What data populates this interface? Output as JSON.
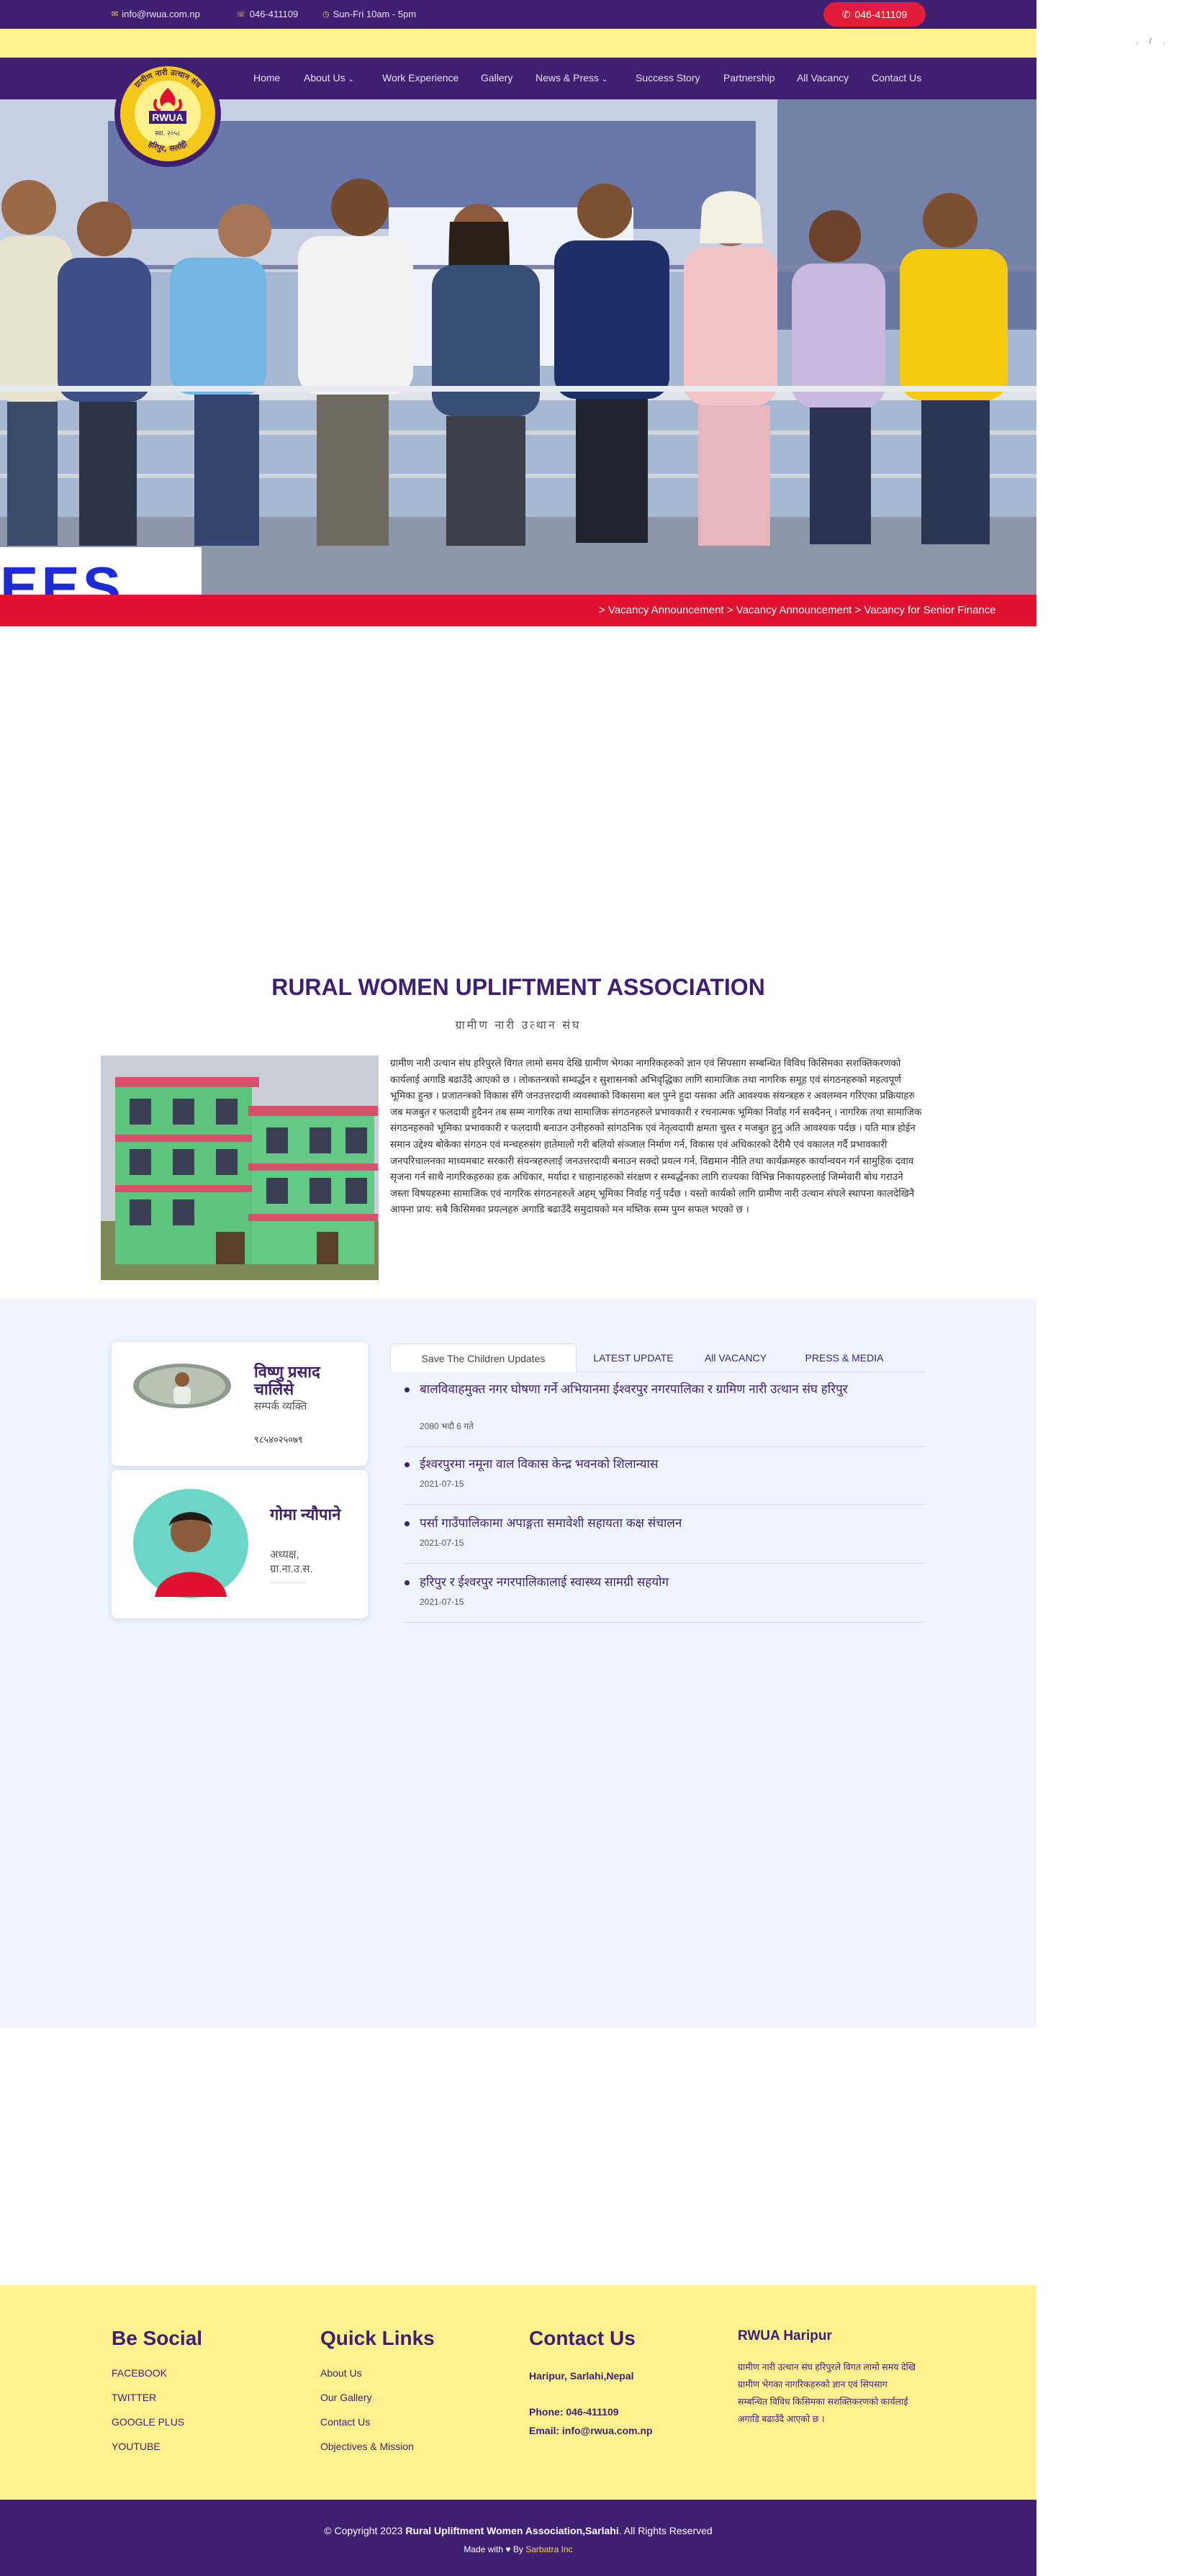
{
  "topbar": {
    "email": "info@rwua.com.np",
    "phone": "046-411109",
    "hours": "Sun-Fri 10am - 5pm",
    "call_button": "046-411109"
  },
  "corner": ". / .",
  "nav": {
    "items": [
      "Home",
      "About Us",
      "Work Experience",
      "Gallery",
      "News & Press",
      "Success Story",
      "Partnership",
      "All Vacancy",
      "Contact Us"
    ]
  },
  "logo": {
    "text_top": "ग्रामीण नारी उत्थान संघ",
    "text_bottom": "हरिपुर, सर्लाही",
    "abbr": "RWUA",
    "year": "स्था. २०५८"
  },
  "hero": {
    "card_text": "EES"
  },
  "ticker": {
    "text": "> Vacancy Announcement > Vacancy Announcement > Vacancy for Senior Finance"
  },
  "about": {
    "title": "RURAL WOMEN UPLIFTMENT ASSOCIATION",
    "subtitle": "ग्रामीण नारी उत्थान संघ",
    "body": "ग्रामीण नारी उत्थान संघ हरिपुरले विगत लामो समय देखि ग्रामीण भेगका नागरिकहरुको ज्ञान एवं सिपसाग सम्बन्धित विविध किसिमका सशक्तिकरणको कार्यलाई अगाडि बढाउँदै आएको छ । लोकतन्त्रको सम्वर्द्धन र सुशासनको अभिवृद्धिका लागि सामाजिक तथा नागरिक समूह एवं संगठनहरुको महत्वपूर्ण भूमिका हुन्छ । प्रजातन्त्रको विकास सँगै जनउत्तरदायी व्यवस्थाको विकासमा बल पुग्ने हुदा यसका अति आवश्यक संयन्त्रहरु र अवलम्वन गरिएका प्रक्रियाहरु जब मजबुत र फलदायी हुदैनन तब सम्म नागरिक तथा सामाजिक संगठनहरुले प्रभावकारी र रचनात्मक भूमिका निर्वाह गर्न सक्दैनन् । नागरिक तथा सामाजिक संगठनहरुको भूमिका प्रभावकारी र फलदायी बनाउन उनीहरुको सांगठनिक एवं नेतृत्वदायी क्षमता चुस्त र मजबुत हुनु अति आवश्यक पर्दछ । यति मात्र होईन समान उद्देश्य बोकेका संगठन एवं मन्चहरुसंग हातेमालो गरी बलियो संञ्जाल निर्माण गर्न, विकास एवं अधिकारको दैरीमै एवं वकालत गर्दै प्रभावकारी जनपरिचालनका माध्यमबाट सरकारी संयन्त्रहरुलाई जनउत्तरदायी बनाउन सक्दो प्रयत्न गर्न, विद्यमान नीति तथा कार्यक्रमहरु कार्यान्वयन गर्न सामुहिक दवाव सृजना गर्न साथै नागरिकहरुका हक अधिकार, मर्यादा र चाहानाहरुको संरक्षण र सम्वर्द्धनका लागि राज्यका विभिन्न निकायहरुलाई जिम्मेवारी बोध गराउने जस्ता विषयहरुमा सामाजिक एवं नागरिक संगठनहरुले अहम् भूमिका निर्वाह गर्नु पर्दछ । यस्तो कार्यको लागि ग्रामीण नारी उत्थान संघले स्थापना कालदेखिनै आफ्ना प्राय: सबै किसिमका प्रयत्नहरु अगाडि बढाउँदै समुदायको मन मष्तिक सम्म पुग्न सफल भएको छ ।"
  },
  "people": [
    {
      "name": "विष्णु प्रसाद चालिसे",
      "role": "सम्पर्क व्यक्ति",
      "extra": "९८५४०२५०७९"
    },
    {
      "name": "गोमा न्यौपाने",
      "role": "अध्यक्ष,\nग्रा.ना.उ.स.",
      "extra": ""
    }
  ],
  "tabs": [
    "Save The Children Updates",
    "LATEST UPDATE",
    "All VACANCY",
    "PRESS & MEDIA"
  ],
  "news": [
    {
      "title": "बालविवाहमुक्त नगर घोषणा गर्ने अभियानमा ईश्वरपुर नगरपालिका र ग्रामिण नारी उत्थान संघ हरिपुर",
      "date": "2080 भदौ 6 गते"
    },
    {
      "title": "ईश्वरपुरमा नमूना वाल विकास केन्द्र भवनको शिलान्यास",
      "date": "2021-07-15"
    },
    {
      "title": "पर्सा गाउँपालिकामा अपाङ्गता समावेशी सहायता कक्ष संचालन",
      "date": "2021-07-15"
    },
    {
      "title": "हरिपुर र ईश्वरपुर नगरपालिकालाई स्वास्थ्य सामग्री सहयोग",
      "date": "2021-07-15"
    }
  ],
  "footer": {
    "social_head": "Be Social",
    "social": [
      "FACEBOOK",
      "TWITTER",
      "GOOGLE PLUS",
      "YOUTUBE"
    ],
    "links_head": "Quick Links",
    "links": [
      "About Us",
      "Our Gallery",
      "Contact Us",
      "Objectives & Mission"
    ],
    "contact_head": "Contact Us",
    "address": "Haripur, Sarlahi,Nepal",
    "phone": "Phone: 046-411109",
    "email": "Email: info@rwua.com.np",
    "rwua_head": "RWUA Haripur",
    "rwua_text": "ग्रामीण नारी उत्थान संघ हरिपुरले विगत लामो समय देखि ग्रामीण भेगका नागरिकहरुको ज्ञान एवं सिपसाग सम्बन्धित विविध किसिमका सशक्तिकरणको कार्यलाई अगाडि बढाउँदै आएको छ ।"
  },
  "bottom": {
    "copy_prefix": "© Copyright 2023",
    "org": "Rural Upliftment Women Association,Sarlahi",
    "copy_suffix": ". All Rights Reserved",
    "made_prefix": "Made with",
    "made_by": "By",
    "credit": "Sarbatra Inc"
  },
  "colors": {
    "brand_purple": "#3f1f72",
    "accent_red": "#e0122f",
    "footer_yellow": "#fff28e",
    "section_blue": "#eef5ff"
  }
}
